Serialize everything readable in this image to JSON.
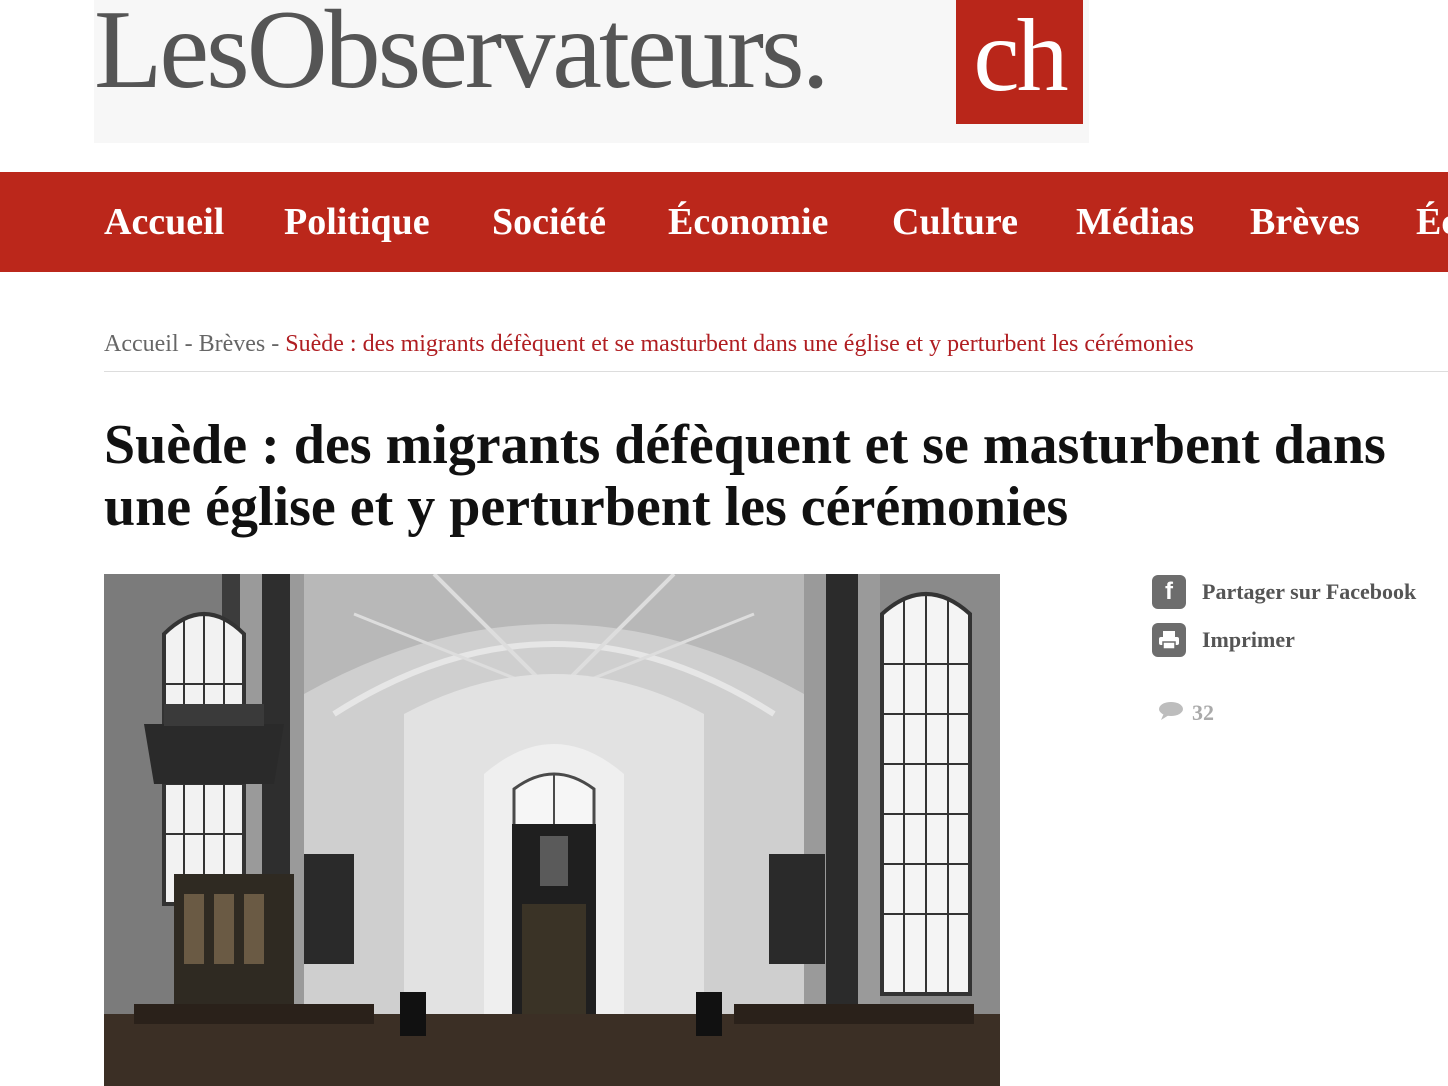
{
  "site": {
    "logo_main": "LesObservateurs.",
    "logo_suffix": "ch",
    "brand_color": "#bb271b"
  },
  "nav": {
    "items": [
      {
        "label": "Accueil"
      },
      {
        "label": "Politique"
      },
      {
        "label": "Société"
      },
      {
        "label": "Économie"
      },
      {
        "label": "Culture"
      },
      {
        "label": "Médias"
      },
      {
        "label": "Brèves"
      },
      {
        "label": "Éc"
      }
    ]
  },
  "breadcrumb": {
    "home": "Accueil",
    "separator": " - ",
    "section": "Brèves",
    "current": "Suède : des migrants défèquent et se masturbent dans une église et y perturbent les cérémonies"
  },
  "article": {
    "title": "Suède : des migrants défèquent et se masturbent dans une église et y perturbent les cérémonies"
  },
  "share": {
    "facebook_label": "Partager sur Facebook",
    "facebook_icon": "facebook-icon",
    "print_label": "Imprimer",
    "print_icon": "printer-icon",
    "comments_count": "32",
    "comments_icon": "comment-bubble-icon"
  }
}
